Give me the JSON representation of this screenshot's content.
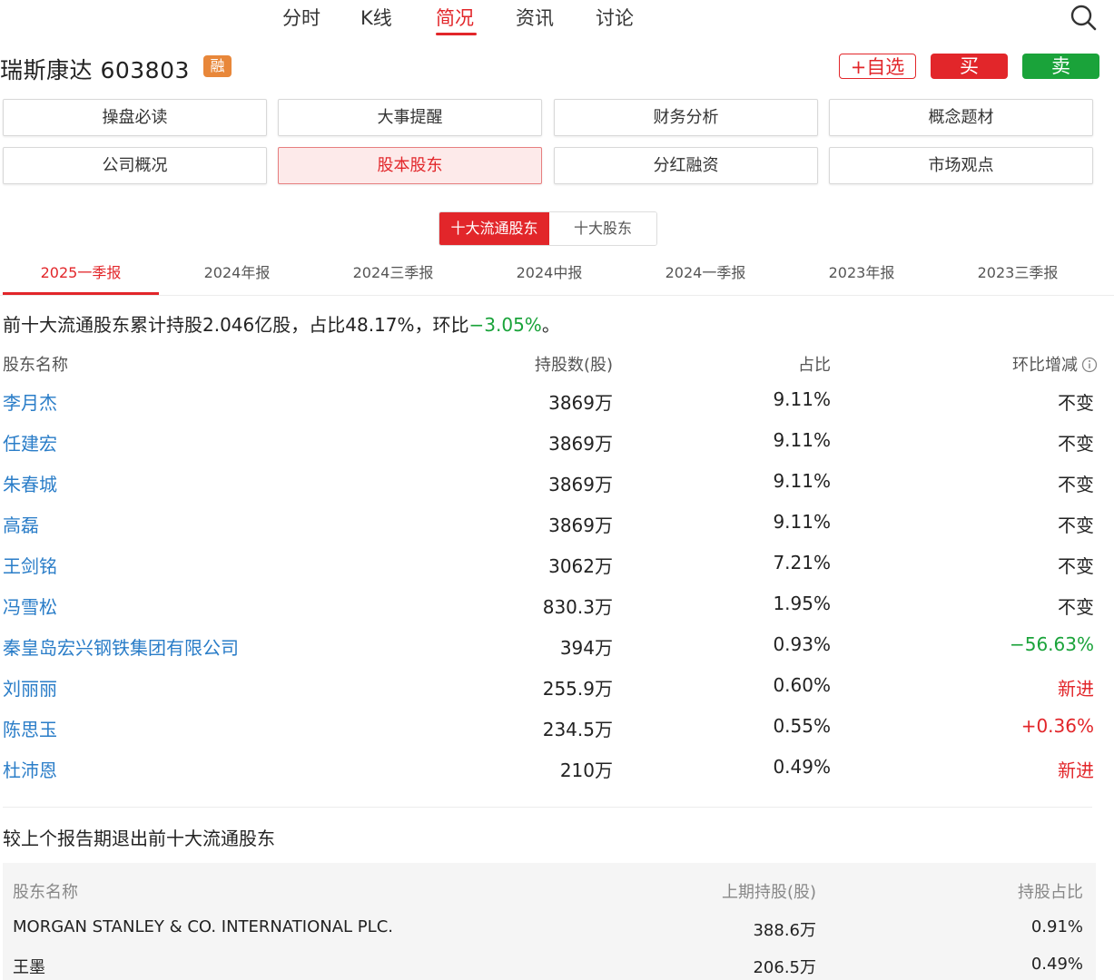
{
  "nav": {
    "tabs": [
      "分时",
      "K线",
      "简况",
      "资讯",
      "讨论"
    ],
    "active": "简况"
  },
  "stock": {
    "name_code": "瑞斯康达 603803",
    "badge": "融",
    "watch_label": "+自选",
    "buy_label": "买",
    "sell_label": "卖"
  },
  "menu": {
    "row1": [
      "操盘必读",
      "大事提醒",
      "财务分析",
      "概念题材"
    ],
    "row2": [
      "公司概况",
      "股本股东",
      "分红融资",
      "市场观点"
    ],
    "active": "股本股东"
  },
  "toggle": {
    "left": "十大流通股东",
    "right": "十大股东",
    "active": "十大流通股东"
  },
  "periods": [
    "2025一季报",
    "2024年报",
    "2024三季报",
    "2024中报",
    "2024一季报",
    "2023年报",
    "2023三季报"
  ],
  "active_period": "2025一季报",
  "summary": {
    "prefix": "前十大流通股东累计持股2.046亿股，占比48.17%，环比",
    "change": "−3.05%",
    "suffix": "。"
  },
  "table": {
    "headers": {
      "name": "股东名称",
      "shares": "持股数(股)",
      "pct": "占比",
      "change": "环比增减"
    },
    "rows": [
      {
        "name": "李月杰",
        "shares": "3869万",
        "pct": "9.11%",
        "change": "不变",
        "status": "neutral"
      },
      {
        "name": "任建宏",
        "shares": "3869万",
        "pct": "9.11%",
        "change": "不变",
        "status": "neutral"
      },
      {
        "name": "朱春城",
        "shares": "3869万",
        "pct": "9.11%",
        "change": "不变",
        "status": "neutral"
      },
      {
        "name": "高磊",
        "shares": "3869万",
        "pct": "9.11%",
        "change": "不变",
        "status": "neutral"
      },
      {
        "name": "王剑铭",
        "shares": "3062万",
        "pct": "7.21%",
        "change": "不变",
        "status": "neutral"
      },
      {
        "name": "冯雪松",
        "shares": "830.3万",
        "pct": "1.95%",
        "change": "不变",
        "status": "neutral"
      },
      {
        "name": "秦皇岛宏兴钢铁集团有限公司",
        "shares": "394万",
        "pct": "0.93%",
        "change": "−56.63%",
        "status": "down"
      },
      {
        "name": "刘丽丽",
        "shares": "255.9万",
        "pct": "0.60%",
        "change": "新进",
        "status": "up"
      },
      {
        "name": "陈思玉",
        "shares": "234.5万",
        "pct": "0.55%",
        "change": "+0.36%",
        "status": "up"
      },
      {
        "name": "杜沛恩",
        "shares": "210万",
        "pct": "0.49%",
        "change": "新进",
        "status": "up"
      }
    ]
  },
  "exited": {
    "title": "较上个报告期退出前十大流通股东",
    "headers": {
      "name": "股东名称",
      "shares": "上期持股(股)",
      "pct": "持股占比"
    },
    "rows": [
      {
        "name": "MORGAN STANLEY & CO. INTERNATIONAL PLC.",
        "shares": "388.6万",
        "pct": "0.91%"
      },
      {
        "name": "王墨",
        "shares": "206.5万",
        "pct": "0.49%"
      }
    ]
  },
  "colors": {
    "accent": "#e2262a",
    "green": "#1aa33a",
    "link": "#2a7dc8",
    "badge": "#e8873a"
  }
}
